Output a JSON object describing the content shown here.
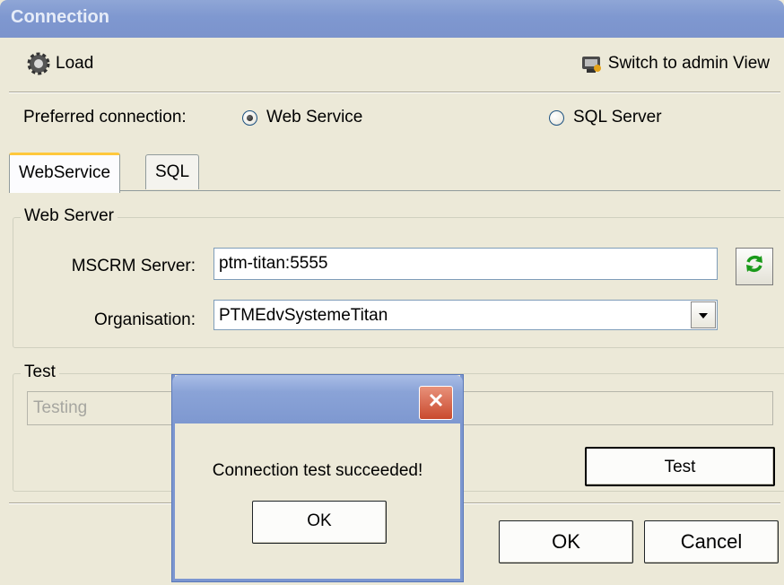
{
  "window": {
    "title": "Connection"
  },
  "toolbar": {
    "load_label": "Load",
    "switch_label": "Switch to admin View"
  },
  "preferred": {
    "label": "Preferred connection:",
    "options": [
      {
        "label": "Web Service",
        "selected": true
      },
      {
        "label": "SQL Server",
        "selected": false
      }
    ]
  },
  "tabs": [
    {
      "label": "WebService",
      "active": true
    },
    {
      "label": "SQL",
      "active": false
    }
  ],
  "web_server": {
    "group_title": "Web Server",
    "server_label": "MSCRM Server:",
    "server_value": "ptm-titan:5555",
    "org_label": "Organisation:",
    "org_value": "PTMEdvSystemeTitan"
  },
  "test": {
    "group_title": "Test",
    "status_value": "Testing",
    "button_label": "Test"
  },
  "footer": {
    "ok_label": "OK",
    "cancel_label": "Cancel"
  },
  "message_box": {
    "text": "Connection test succeeded!",
    "ok_label": "OK"
  },
  "icons": {
    "load": "gear-icon",
    "switch": "admin-icon",
    "refresh": "refresh-icon",
    "dropdown": "chevron-down-icon",
    "close": "close-icon"
  }
}
